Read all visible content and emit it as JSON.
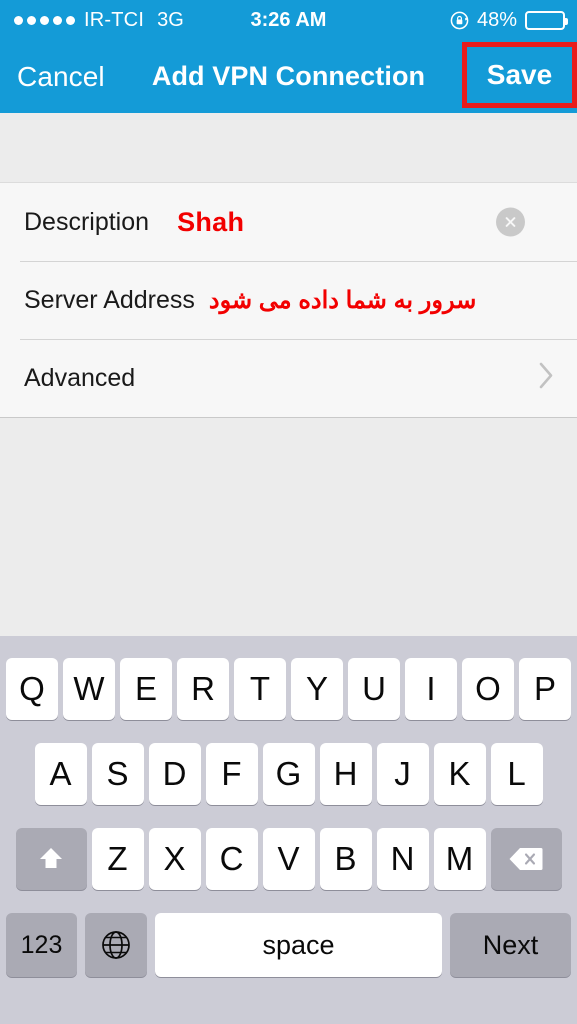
{
  "statusbar": {
    "signal_dots": 5,
    "carrier": "IR-TCI",
    "network": "3G",
    "time": "3:26 AM",
    "rotation_lock_icon": "rotation-lock-icon",
    "battery_percent": "48%",
    "battery_level": 48
  },
  "navbar": {
    "cancel_label": "Cancel",
    "title": "Add VPN Connection",
    "save_label": "Save",
    "highlight_color": "#e81c1c",
    "bar_color": "#149bd7"
  },
  "form": {
    "rows": [
      {
        "label": "Description",
        "value": "Shah",
        "value_color": "#f20000",
        "has_clear_button": true
      },
      {
        "label": "Server Address",
        "value": "سرور به شما داده می شود",
        "value_color": "#f20000",
        "has_clear_button": false
      },
      {
        "label": "Advanced",
        "value": "",
        "has_chevron": true
      }
    ]
  },
  "keyboard": {
    "row1": [
      "Q",
      "W",
      "E",
      "R",
      "T",
      "Y",
      "U",
      "I",
      "O",
      "P"
    ],
    "row2": [
      "A",
      "S",
      "D",
      "F",
      "G",
      "H",
      "J",
      "K",
      "L"
    ],
    "row3": [
      "Z",
      "X",
      "C",
      "V",
      "B",
      "N",
      "M"
    ],
    "shift_icon": "shift-up-arrow-icon",
    "backspace_icon": "backspace-delete-icon",
    "numeric_label": "123",
    "globe_icon": "globe-language-icon",
    "space_label": "space",
    "return_label": "Next",
    "background_color": "#ccccd6"
  }
}
